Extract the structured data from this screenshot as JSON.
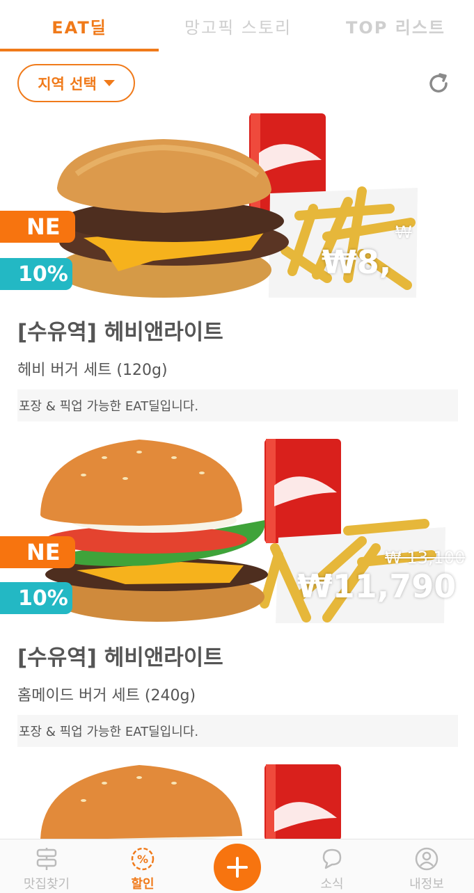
{
  "tabs": [
    {
      "label": "EAT딜",
      "active": true
    },
    {
      "label": "망고픽 스토리",
      "active": false
    },
    {
      "label": "TOP 리스트",
      "active": false
    }
  ],
  "region": {
    "label": "지역 선택"
  },
  "deals": [
    {
      "badge_new": "NE",
      "discount": "10%",
      "original_price": "₩",
      "price": "₩8,",
      "title": "[수유역] 헤비앤라이트",
      "item": "헤비 버거 세트 (120g)",
      "note": "포장 & 픽업 가능한 EAT딜입니다."
    },
    {
      "badge_new": "NE",
      "discount": "10%",
      "original_price": "₩ 13,100",
      "price": "₩11,790",
      "title": "[수유역] 헤비앤라이트",
      "item": "홈메이드 버거 세트 (240g)",
      "note": "포장 & 픽업 가능한 EAT딜입니다."
    }
  ],
  "bottom_nav": [
    {
      "label": "맛집찾기",
      "icon": "signpost-icon",
      "active": false
    },
    {
      "label": "할인",
      "icon": "discount-icon",
      "active": true
    },
    {
      "label": "",
      "icon": "plus-icon",
      "active": false
    },
    {
      "label": "소식",
      "icon": "chat-icon",
      "active": false
    },
    {
      "label": "내정보",
      "icon": "user-icon",
      "active": false
    }
  ],
  "colors": {
    "accent": "#f07a1a",
    "new_badge": "#f7740f",
    "discount_badge": "#23b8c4",
    "inactive": "#cfcfcf"
  }
}
